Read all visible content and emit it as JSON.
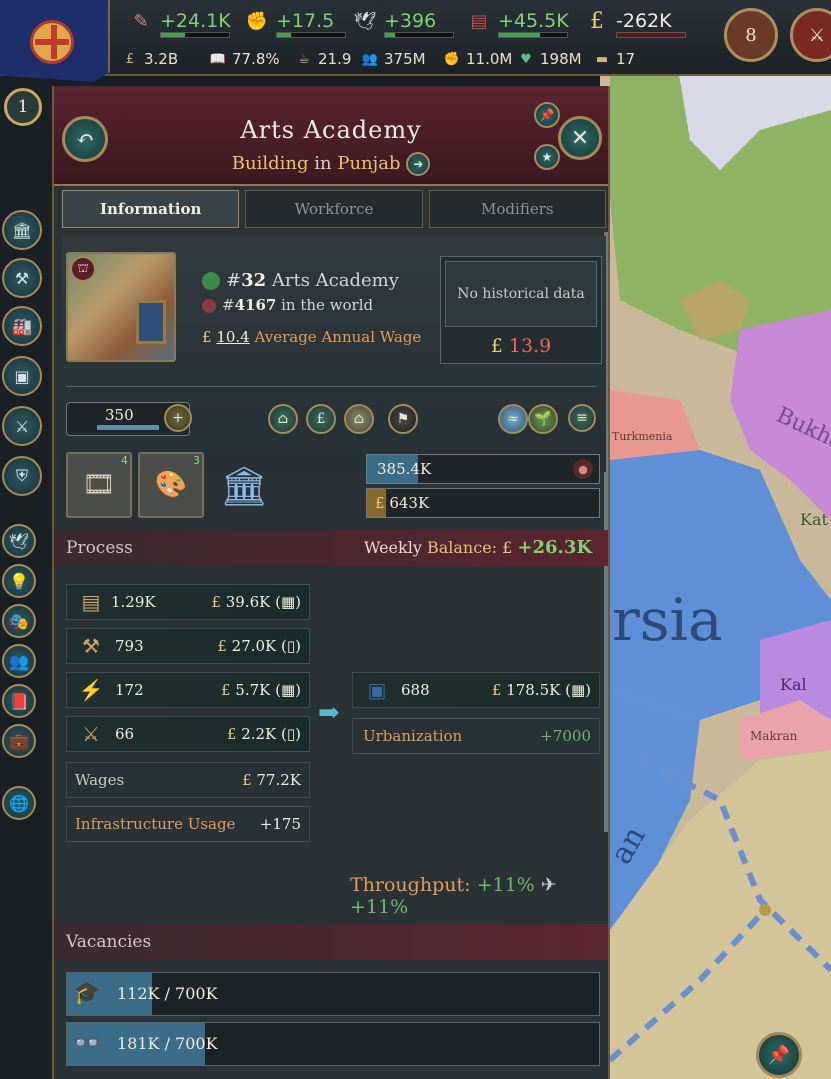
{
  "topbar": {
    "resources": [
      {
        "icon": "bureaucracy-icon",
        "value": "+24.1K",
        "fill": 0.35
      },
      {
        "icon": "authority-icon",
        "value": "+17.5",
        "fill": 0.2
      },
      {
        "icon": "influence-icon",
        "value": "+396",
        "fill": 0.15
      },
      {
        "icon": "money-balance-icon",
        "value": "+45.5K",
        "fill": 0.6
      },
      {
        "icon": "pound-icon",
        "value": "-262K",
        "fill": 0.0
      }
    ],
    "stats": [
      {
        "icon": "gdp-icon",
        "value": "3.2B"
      },
      {
        "icon": "literacy-icon",
        "value": "77.8%"
      },
      {
        "icon": "standard-of-living-icon",
        "value": "21.9"
      },
      {
        "icon": "population-icon",
        "value": "375M"
      },
      {
        "icon": "army-icon",
        "value": "11.0M"
      },
      {
        "icon": "loyalists-icon",
        "value": "198M"
      },
      {
        "icon": "infamy-icon",
        "value": "17"
      }
    ],
    "alerts": {
      "count": "8"
    },
    "rank": "1"
  },
  "panel": {
    "title": "Arts Academy",
    "subtitle_type": "Building",
    "subtitle_in": "in",
    "subtitle_state": "Punjab",
    "tabs": [
      "Information",
      "Workforce",
      "Modifiers"
    ],
    "rank_country_prefix": "#",
    "rank_country_num": "32",
    "rank_country_label": "Arts Academy",
    "rank_world_prefix": "#",
    "rank_world_num": "4167",
    "rank_world_label": "in the world",
    "wage_value": "10.4",
    "wage_label": "Average Annual Wage",
    "no_history": "No historical data",
    "price": "13.9",
    "level": "350",
    "slot_counts": [
      "4",
      "3"
    ],
    "cash_reserves": "385.4K",
    "cash_max": "643K",
    "process_label": "Process",
    "weekly_label": "Weekly",
    "balance_label": "Balance:",
    "balance_value": "+26.3K",
    "inputs": [
      {
        "icon": "paper-icon",
        "qty": "1.29K",
        "price": "39.6K"
      },
      {
        "icon": "tools-icon",
        "qty": "793",
        "price": "27.0K"
      },
      {
        "icon": "electricity-icon",
        "qty": "172",
        "price": "5.7K"
      },
      {
        "icon": "small-arms-icon",
        "qty": "66",
        "price": "2.2K"
      }
    ],
    "output": {
      "icon": "fine-art-icon",
      "qty": "688",
      "price": "178.5K"
    },
    "urbanization_label": "Urbanization",
    "urbanization_value": "+7000",
    "wages_label": "Wages",
    "wages_value": "77.2K",
    "infra_label": "Infrastructure Usage",
    "infra_value": "+175",
    "throughput_label": "Throughput:",
    "throughput_a": "+11%",
    "throughput_b": "+11%",
    "vacancies_label": "Vacancies",
    "vacancies": [
      {
        "icon": "academics-icon",
        "text": "112K / 700K",
        "fill": 0.16
      },
      {
        "icon": "clerks-icon",
        "text": "181K / 700K",
        "fill": 0.26
      }
    ]
  },
  "map": {
    "labels": [
      "Turkmenia",
      "Bukhara",
      "rsia",
      "Kal",
      "Makran",
      "Kat",
      "an"
    ]
  },
  "colors": {
    "accent_gold": "#e7c46a",
    "positive": "#7fd36f",
    "negative": "#e86a5a",
    "panel_maroon": "#5a2430"
  }
}
